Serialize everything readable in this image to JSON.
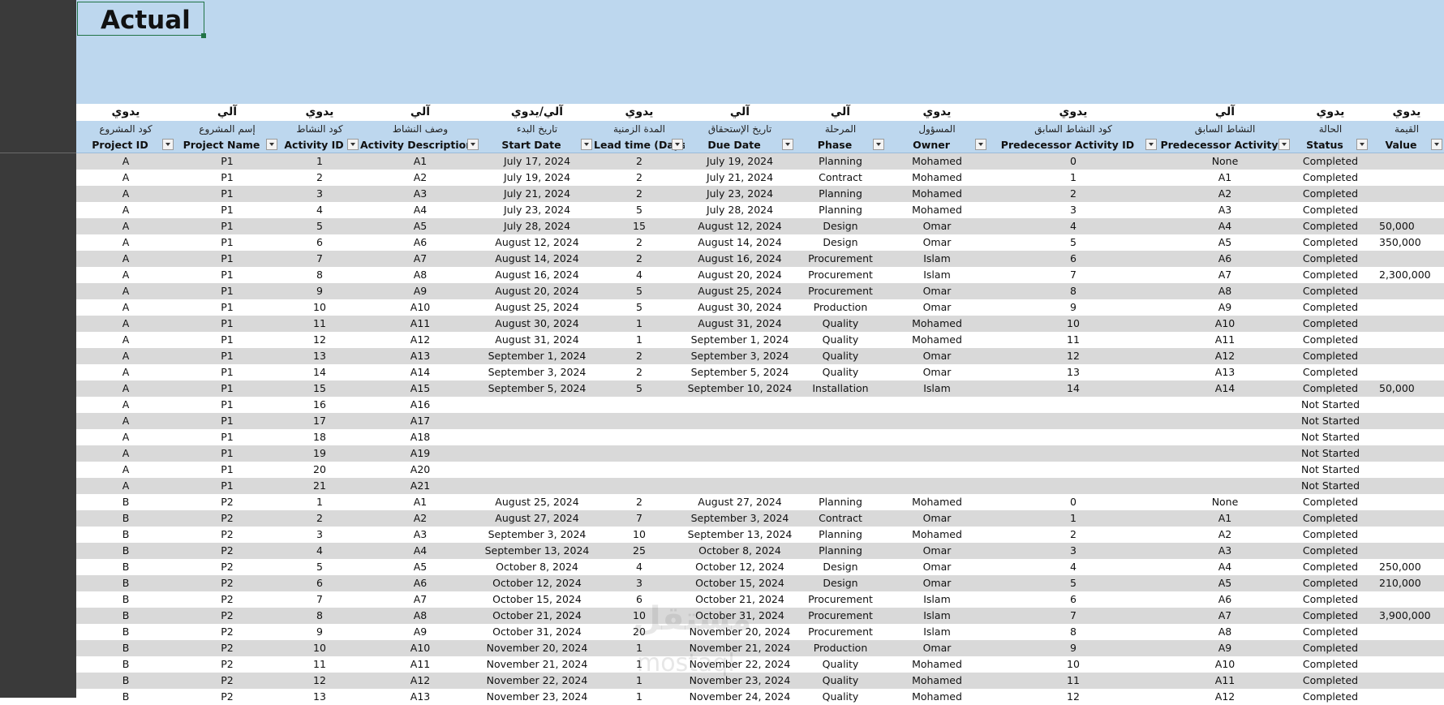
{
  "sheet": {
    "title": "Actual"
  },
  "columns": [
    {
      "type_ar": "يدوي",
      "label_ar": "كود المشروع",
      "header": "Project ID"
    },
    {
      "type_ar": "آلي",
      "label_ar": "إسم المشروع",
      "header": "Project Name"
    },
    {
      "type_ar": "يدوي",
      "label_ar": "كود النشاط",
      "header": "Activity ID"
    },
    {
      "type_ar": "آلي",
      "label_ar": "وصف النشاط",
      "header": "Activity Description"
    },
    {
      "type_ar": "آلي/يدوي",
      "label_ar": "تاريخ البدء",
      "header": "Start Date"
    },
    {
      "type_ar": "يدوي",
      "label_ar": "المدة الزمنية",
      "header": "Lead time (Days"
    },
    {
      "type_ar": "آلي",
      "label_ar": "تاريخ الإستحقاق",
      "header": "Due Date"
    },
    {
      "type_ar": "آلي",
      "label_ar": "المرحلة",
      "header": "Phase"
    },
    {
      "type_ar": "يدوي",
      "label_ar": "المسؤول",
      "header": "Owner"
    },
    {
      "type_ar": "يدوي",
      "label_ar": "كود النشاط السابق",
      "header": "Predecessor Activity ID"
    },
    {
      "type_ar": "آلي",
      "label_ar": "النشاط السابق",
      "header": "Predecessor Activity"
    },
    {
      "type_ar": "يدوي",
      "label_ar": "الحالة",
      "header": "Status"
    },
    {
      "type_ar": "يدوي",
      "label_ar": "القيمة",
      "header": "Value"
    }
  ],
  "rows": [
    [
      "A",
      "P1",
      "1",
      "A1",
      "July 17, 2024",
      "2",
      "July 19, 2024",
      "Planning",
      "Mohamed",
      "0",
      "None",
      "Completed",
      ""
    ],
    [
      "A",
      "P1",
      "2",
      "A2",
      "July 19, 2024",
      "2",
      "July 21, 2024",
      "Contract",
      "Mohamed",
      "1",
      "A1",
      "Completed",
      ""
    ],
    [
      "A",
      "P1",
      "3",
      "A3",
      "July 21, 2024",
      "2",
      "July 23, 2024",
      "Planning",
      "Mohamed",
      "2",
      "A2",
      "Completed",
      ""
    ],
    [
      "A",
      "P1",
      "4",
      "A4",
      "July 23, 2024",
      "5",
      "July 28, 2024",
      "Planning",
      "Mohamed",
      "3",
      "A3",
      "Completed",
      ""
    ],
    [
      "A",
      "P1",
      "5",
      "A5",
      "July 28, 2024",
      "15",
      "August 12, 2024",
      "Design",
      "Omar",
      "4",
      "A4",
      "Completed",
      "50,000"
    ],
    [
      "A",
      "P1",
      "6",
      "A6",
      "August 12, 2024",
      "2",
      "August 14, 2024",
      "Design",
      "Omar",
      "5",
      "A5",
      "Completed",
      "350,000"
    ],
    [
      "A",
      "P1",
      "7",
      "A7",
      "August 14, 2024",
      "2",
      "August 16, 2024",
      "Procurement",
      "Islam",
      "6",
      "A6",
      "Completed",
      ""
    ],
    [
      "A",
      "P1",
      "8",
      "A8",
      "August 16, 2024",
      "4",
      "August 20, 2024",
      "Procurement",
      "Islam",
      "7",
      "A7",
      "Completed",
      "2,300,000"
    ],
    [
      "A",
      "P1",
      "9",
      "A9",
      "August 20, 2024",
      "5",
      "August 25, 2024",
      "Procurement",
      "Omar",
      "8",
      "A8",
      "Completed",
      ""
    ],
    [
      "A",
      "P1",
      "10",
      "A10",
      "August 25, 2024",
      "5",
      "August 30, 2024",
      "Production",
      "Omar",
      "9",
      "A9",
      "Completed",
      ""
    ],
    [
      "A",
      "P1",
      "11",
      "A11",
      "August 30, 2024",
      "1",
      "August 31, 2024",
      "Quality",
      "Mohamed",
      "10",
      "A10",
      "Completed",
      ""
    ],
    [
      "A",
      "P1",
      "12",
      "A12",
      "August 31, 2024",
      "1",
      "September 1, 2024",
      "Quality",
      "Mohamed",
      "11",
      "A11",
      "Completed",
      ""
    ],
    [
      "A",
      "P1",
      "13",
      "A13",
      "September 1, 2024",
      "2",
      "September 3, 2024",
      "Quality",
      "Omar",
      "12",
      "A12",
      "Completed",
      ""
    ],
    [
      "A",
      "P1",
      "14",
      "A14",
      "September 3, 2024",
      "2",
      "September 5, 2024",
      "Quality",
      "Omar",
      "13",
      "A13",
      "Completed",
      ""
    ],
    [
      "A",
      "P1",
      "15",
      "A15",
      "September 5, 2024",
      "5",
      "September 10, 2024",
      "Installation",
      "Islam",
      "14",
      "A14",
      "Completed",
      "50,000"
    ],
    [
      "A",
      "P1",
      "16",
      "A16",
      "",
      "",
      "",
      "",
      "",
      "",
      "",
      "Not Started",
      ""
    ],
    [
      "A",
      "P1",
      "17",
      "A17",
      "",
      "",
      "",
      "",
      "",
      "",
      "",
      "Not Started",
      ""
    ],
    [
      "A",
      "P1",
      "18",
      "A18",
      "",
      "",
      "",
      "",
      "",
      "",
      "",
      "Not Started",
      ""
    ],
    [
      "A",
      "P1",
      "19",
      "A19",
      "",
      "",
      "",
      "",
      "",
      "",
      "",
      "Not Started",
      ""
    ],
    [
      "A",
      "P1",
      "20",
      "A20",
      "",
      "",
      "",
      "",
      "",
      "",
      "",
      "Not Started",
      ""
    ],
    [
      "A",
      "P1",
      "21",
      "A21",
      "",
      "",
      "",
      "",
      "",
      "",
      "",
      "Not Started",
      ""
    ],
    [
      "B",
      "P2",
      "1",
      "A1",
      "August 25, 2024",
      "2",
      "August 27, 2024",
      "Planning",
      "Mohamed",
      "0",
      "None",
      "Completed",
      ""
    ],
    [
      "B",
      "P2",
      "2",
      "A2",
      "August 27, 2024",
      "7",
      "September 3, 2024",
      "Contract",
      "Omar",
      "1",
      "A1",
      "Completed",
      ""
    ],
    [
      "B",
      "P2",
      "3",
      "A3",
      "September 3, 2024",
      "10",
      "September 13, 2024",
      "Planning",
      "Mohamed",
      "2",
      "A2",
      "Completed",
      ""
    ],
    [
      "B",
      "P2",
      "4",
      "A4",
      "September 13, 2024",
      "25",
      "October 8, 2024",
      "Planning",
      "Omar",
      "3",
      "A3",
      "Completed",
      ""
    ],
    [
      "B",
      "P2",
      "5",
      "A5",
      "October 8, 2024",
      "4",
      "October 12, 2024",
      "Design",
      "Omar",
      "4",
      "A4",
      "Completed",
      "250,000"
    ],
    [
      "B",
      "P2",
      "6",
      "A6",
      "October 12, 2024",
      "3",
      "October 15, 2024",
      "Design",
      "Omar",
      "5",
      "A5",
      "Completed",
      "210,000"
    ],
    [
      "B",
      "P2",
      "7",
      "A7",
      "October 15, 2024",
      "6",
      "October 21, 2024",
      "Procurement",
      "Islam",
      "6",
      "A6",
      "Completed",
      ""
    ],
    [
      "B",
      "P2",
      "8",
      "A8",
      "October 21, 2024",
      "10",
      "October 31, 2024",
      "Procurement",
      "Islam",
      "7",
      "A7",
      "Completed",
      "3,900,000"
    ],
    [
      "B",
      "P2",
      "9",
      "A9",
      "October 31, 2024",
      "20",
      "November 20, 2024",
      "Procurement",
      "Islam",
      "8",
      "A8",
      "Completed",
      ""
    ],
    [
      "B",
      "P2",
      "10",
      "A10",
      "November 20, 2024",
      "1",
      "November 21, 2024",
      "Production",
      "Omar",
      "9",
      "A9",
      "Completed",
      ""
    ],
    [
      "B",
      "P2",
      "11",
      "A11",
      "November 21, 2024",
      "1",
      "November 22, 2024",
      "Quality",
      "Mohamed",
      "10",
      "A10",
      "Completed",
      ""
    ],
    [
      "B",
      "P2",
      "12",
      "A12",
      "November 22, 2024",
      "1",
      "November 23, 2024",
      "Quality",
      "Mohamed",
      "11",
      "A11",
      "Completed",
      ""
    ],
    [
      "B",
      "P2",
      "13",
      "A13",
      "November 23, 2024",
      "1",
      "November 24, 2024",
      "Quality",
      "Mohamed",
      "12",
      "A12",
      "Completed",
      ""
    ]
  ],
  "watermark": {
    "line1": "مستقل",
    "line2": "mostaql"
  }
}
